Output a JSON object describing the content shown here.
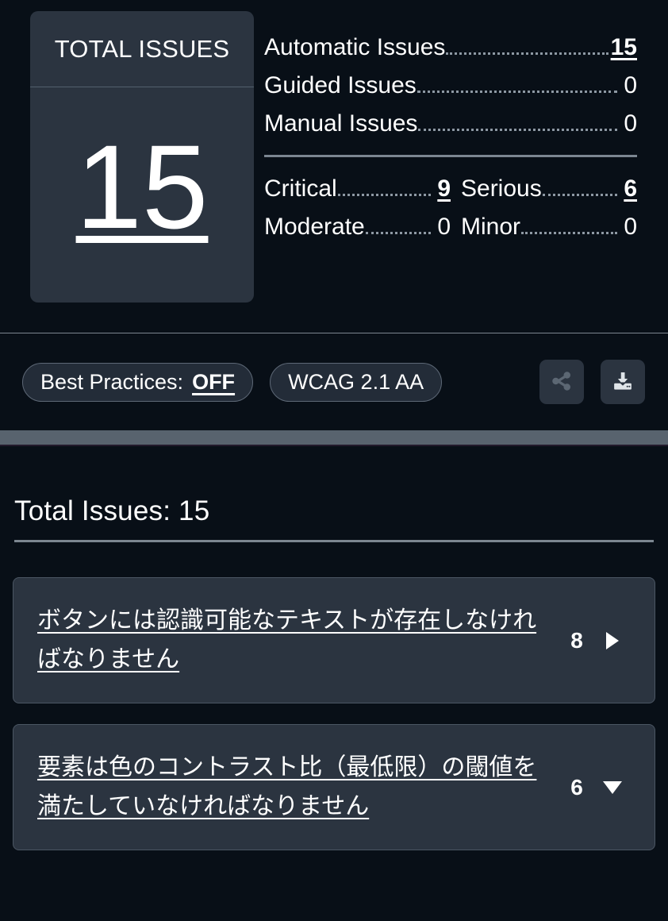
{
  "summary": {
    "total_card": {
      "label": "TOTAL ISSUES",
      "value": "15"
    },
    "breakdown": [
      {
        "label": "Automatic Issues",
        "value": "15",
        "is_link": true
      },
      {
        "label": "Guided Issues",
        "value": "0",
        "is_link": false
      },
      {
        "label": "Manual Issues",
        "value": "0",
        "is_link": false
      }
    ],
    "severity": [
      {
        "label": "Critical",
        "value": "9",
        "is_link": true
      },
      {
        "label": "Serious",
        "value": "6",
        "is_link": true
      },
      {
        "label": "Moderate",
        "value": "0",
        "is_link": false
      },
      {
        "label": "Minor",
        "value": "0",
        "is_link": false
      }
    ]
  },
  "controls": {
    "best_practices": {
      "label": "Best Practices:",
      "state": "OFF"
    },
    "standard": {
      "label": "WCAG 2.1 AA"
    },
    "share_icon": "share-icon",
    "download_icon": "download-icon"
  },
  "issues": {
    "heading": "Total Issues: 15",
    "list": [
      {
        "title": "ボタンには認識可能なテキストが存在しなければなりません",
        "count": "8",
        "expanded": false,
        "toggle_icon": "triangle-right-icon"
      },
      {
        "title": "要素は色のコントラスト比（最低限）の閾値を満たしていなければなりません",
        "count": "6",
        "expanded": true,
        "toggle_icon": "triangle-down-icon"
      }
    ]
  },
  "colors": {
    "page_background": "#080f17",
    "card_background": "#2b3440",
    "divider": "#7c8690",
    "scroll_band": "#58636e",
    "text": "#ffffff",
    "share_icon": "#5c6773",
    "download_icon": "#dfe4e8"
  }
}
